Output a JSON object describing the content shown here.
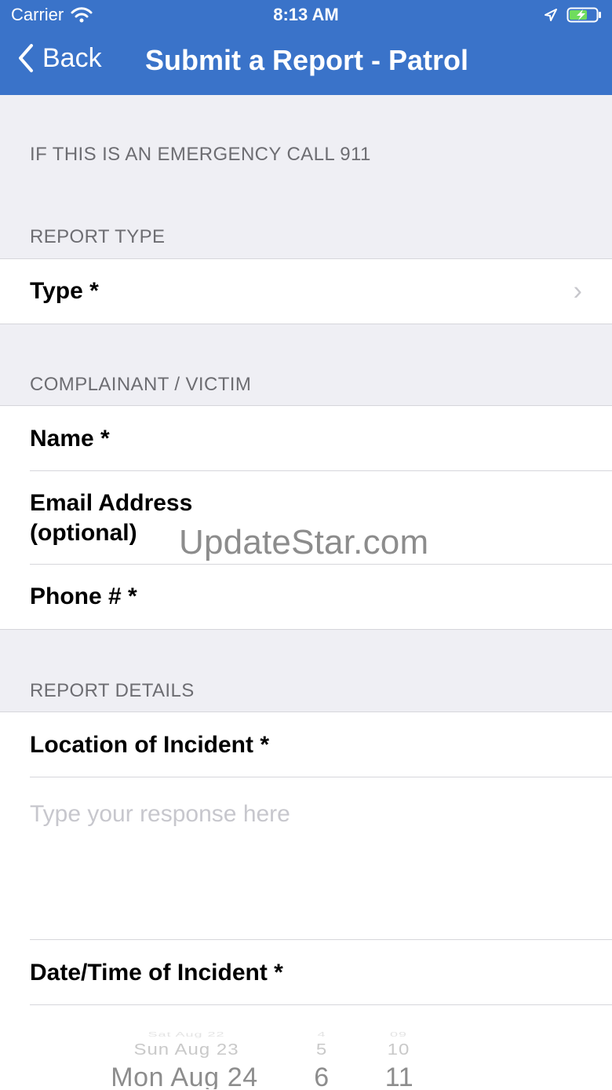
{
  "status_bar": {
    "carrier": "Carrier",
    "time": "8:13 AM"
  },
  "nav": {
    "back_label": "Back",
    "title": "Submit a Report - Patrol"
  },
  "content": {
    "emergency_note": "IF THIS IS AN EMERGENCY CALL 911",
    "sections": [
      {
        "header": "REPORT TYPE",
        "rows": [
          {
            "label": "Type *"
          }
        ]
      },
      {
        "header": "COMPLAINANT / VICTIM",
        "rows": [
          {
            "label": "Name *"
          },
          {
            "label": "Email Address (optional)"
          },
          {
            "label": "Phone # *"
          }
        ]
      },
      {
        "header": "REPORT DETAILS",
        "rows": [
          {
            "label": "Location of Incident *"
          },
          {
            "label": "Date/Time of Incident *"
          }
        ],
        "response_placeholder": "Type your response here"
      }
    ]
  },
  "picker": {
    "rows": [
      {
        "date": "Sat Aug 22",
        "hour": "4",
        "minute": "09"
      },
      {
        "date": "Sun Aug 23",
        "hour": "5",
        "minute": "10"
      },
      {
        "date": "Mon Aug 24",
        "hour": "6",
        "minute": "11"
      }
    ]
  },
  "watermark": {
    "text": "UpdateStar.com"
  },
  "colors": {
    "header_bg": "#3a73c9",
    "page_bg": "#efeff4",
    "section_text": "#6d6d72",
    "placeholder_text": "#c7c7cd",
    "border": "#d6d6db"
  }
}
